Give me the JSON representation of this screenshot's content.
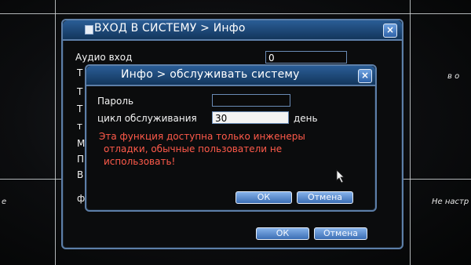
{
  "background": {
    "right_top_label": "в о",
    "right_mid_label": "Не настр",
    "left_mid_label": "e"
  },
  "outer_dialog": {
    "title": "ВХОД В СИСТЕМУ > Инфо",
    "audio_label": "Аудио вход",
    "audio_value": "0",
    "partial_labels": [
      "Т",
      "Т",
      "Т",
      "т",
      "М",
      "П",
      "В",
      "ф"
    ],
    "ok_label": "ОК",
    "cancel_label": "Отмена"
  },
  "inner_dialog": {
    "title": "Инфо > обслуживать систему",
    "password_label": "Пароль",
    "password_value": "",
    "cycle_label": "цикл обслуживания",
    "cycle_value": "30",
    "cycle_unit": "день",
    "warning_lines": [
      "Эта функция доступна только инженеры",
      "отладки, обычные пользователи не",
      "использовать!"
    ],
    "ok_label": "ОК",
    "cancel_label": "Отмена"
  },
  "icons": {
    "close": "close-icon",
    "title": "window-icon",
    "pointer": "mouse-pointer-icon"
  },
  "colors": {
    "title_bar": "#1f4a7c",
    "border": "#5d7fa8",
    "warning": "#ff5a4a",
    "button": "#5a8fd4"
  }
}
